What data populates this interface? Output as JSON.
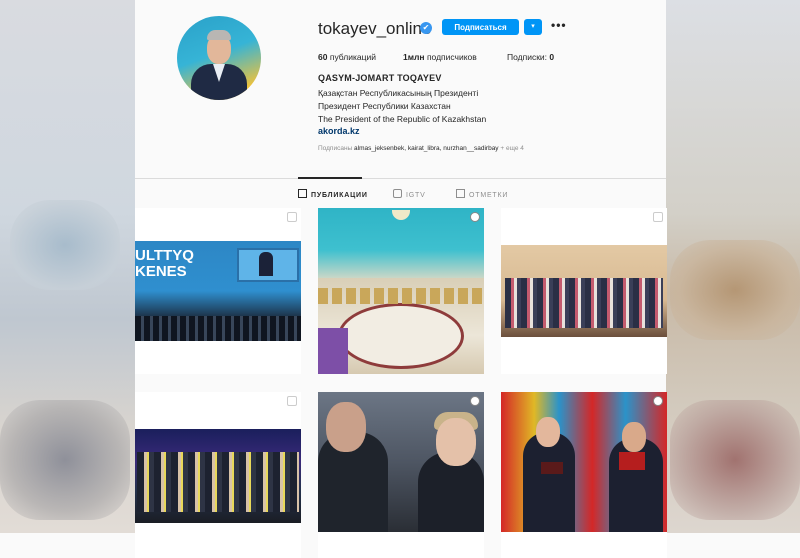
{
  "profile": {
    "username": "tokayev_online",
    "verified_icon": "✔",
    "follow_label": "Подписаться",
    "dropdown_icon": "▾",
    "more_icon": "•••",
    "stats": {
      "posts_count": "60",
      "posts_label": "публикаций",
      "followers_count": "1млн",
      "followers_label": "подписчиков",
      "following_label": "Подписки:",
      "following_count": "0"
    },
    "full_name": "QASYM-JOMART TOQAYEV",
    "bio_lines": [
      "Қазақстан Республикасының Президенті",
      "Президент Республики Казахстан",
      "The President of the Republic of Kazakhstan"
    ],
    "website": "akorda.kz",
    "followed_by_prefix": "Подписаны",
    "followed_by_names": "almas_jeksenbek, kairat_libra, nurzhan__sadirbay",
    "followed_by_more": "+ еще 4"
  },
  "tabs": [
    {
      "label": "ПУБЛИКАЦИИ",
      "icon": "grid-icon",
      "active": true
    },
    {
      "label": "IGTV",
      "icon": "igtv-icon",
      "active": false
    },
    {
      "label": "ОТМЕТКИ",
      "icon": "tag-icon",
      "active": false
    }
  ],
  "posts": {
    "tile1_text": "ULTTYQ\nKENES"
  },
  "colors": {
    "accent": "#0095f6",
    "link": "#00376b",
    "muted": "#8e8e8e",
    "text": "#262626"
  }
}
